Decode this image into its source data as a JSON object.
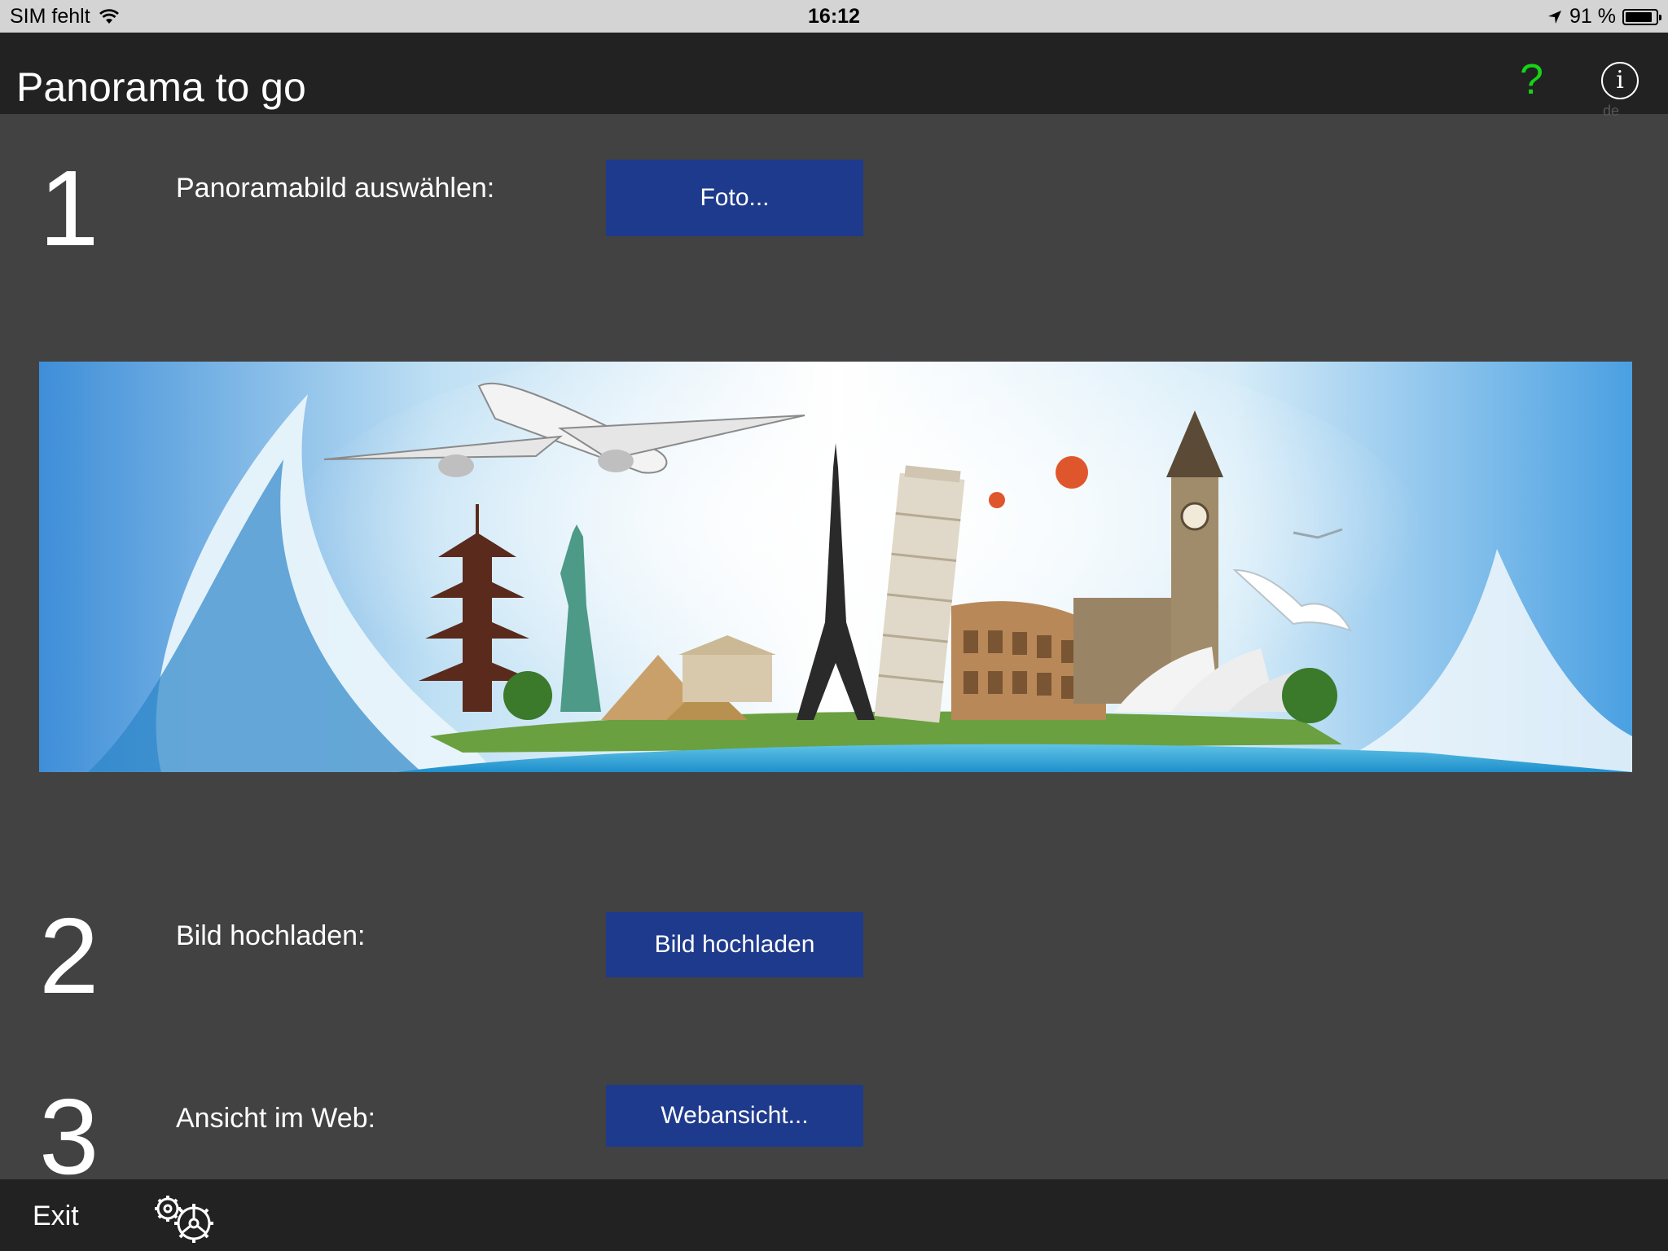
{
  "status": {
    "carrier": "SIM fehlt",
    "time": "16:12",
    "battery_text": "91 %",
    "battery_level": 0.91
  },
  "nav": {
    "title": "Panorama to go",
    "help_glyph": "?",
    "info_glyph": "i",
    "info_caption": "de"
  },
  "steps": [
    {
      "number": "1",
      "label": "Panoramabild auswählen:",
      "button": "Foto..."
    },
    {
      "number": "2",
      "label": "Bild hochladen:",
      "button": "Bild hochladen"
    },
    {
      "number": "3",
      "label": "Ansicht im Web:",
      "button": "Webansicht..."
    }
  ],
  "bottom": {
    "exit_label": "Exit"
  },
  "icons": {
    "wifi": "wifi-icon",
    "location": "location-arrow-icon",
    "battery": "battery-icon",
    "help": "help-icon",
    "info": "info-icon",
    "settings": "gears-icon"
  },
  "colors": {
    "accent_button": "#1e3a8c",
    "help_green": "#16d416",
    "background": "#424242",
    "bar": "#222222",
    "statusbar": "#d4d4d4"
  }
}
